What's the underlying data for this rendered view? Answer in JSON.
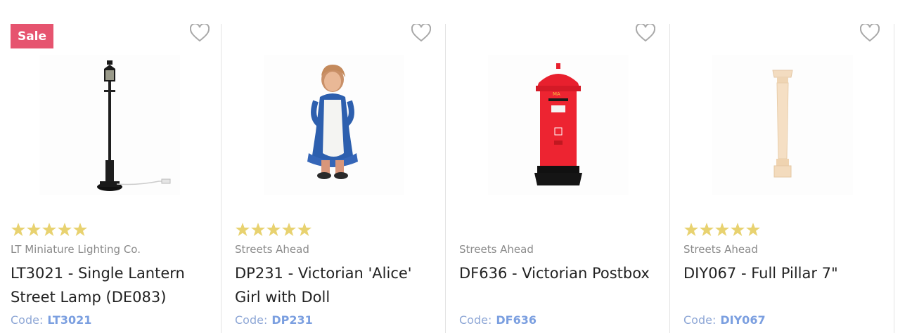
{
  "products": [
    {
      "sale_badge": "Sale",
      "rating": 5,
      "brand": "LT Miniature Lighting Co.",
      "title": "LT3021 - Single Lantern Street Lamp (DE083)",
      "code_label": "Code:",
      "code": "LT3021",
      "image_icon": "street-lamp-icon"
    },
    {
      "rating": 5,
      "brand": "Streets Ahead",
      "title": "DP231 - Victorian 'Alice' Girl with Doll",
      "code_label": "Code:",
      "code": "DP231",
      "image_icon": "victorian-girl-icon"
    },
    {
      "rating": 0,
      "brand": "Streets Ahead",
      "title": "DF636 - Victorian Postbox",
      "code_label": "Code:",
      "code": "DF636",
      "image_icon": "postbox-icon"
    },
    {
      "rating": 5,
      "brand": "Streets Ahead",
      "title": "DIY067 - Full Pillar 7\"",
      "code_label": "Code:",
      "code": "DIY067",
      "image_icon": "pillar-icon"
    }
  ],
  "colors": {
    "sale": "#e6546f",
    "star": "#e8d270",
    "code": "#7b9fe0",
    "postbox": "#e8202e"
  }
}
